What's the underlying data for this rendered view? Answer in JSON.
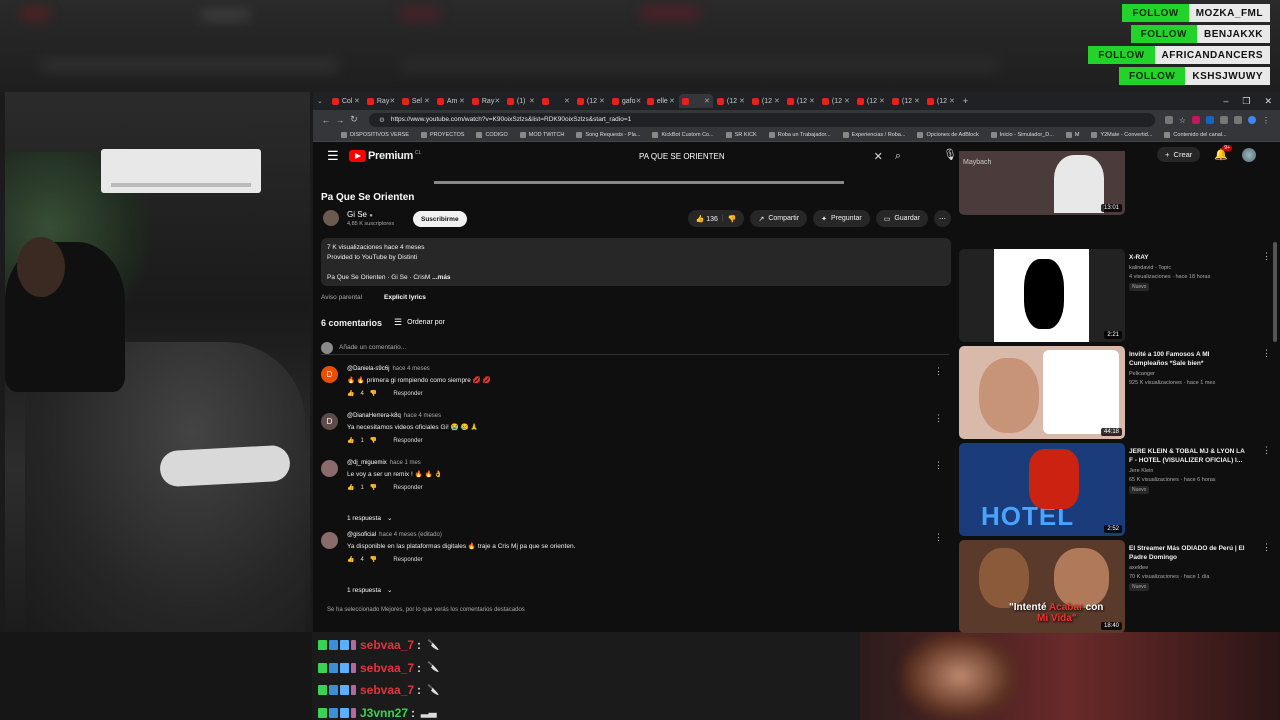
{
  "follows": [
    {
      "label": "FOLLOW",
      "user": "MOZKA_FML"
    },
    {
      "label": "FOLLOW",
      "user": "BENJAKXK"
    },
    {
      "label": "FOLLOW",
      "user": "AFRICANDANCERS"
    },
    {
      "label": "FOLLOW",
      "user": "KSHSJWUWY"
    }
  ],
  "browser": {
    "tabs": [
      "Col",
      "Ray",
      "Sel",
      "Am",
      "Ray",
      "(1)",
      "",
      "(12",
      "gafo",
      "elle",
      "",
      "(12",
      "(12",
      "(12",
      "(12",
      "(12",
      "(12",
      "(12"
    ],
    "url": "https://www.youtube.com/watch?v=K90oixSzlzs&list=RDK90oixSzlzs&start_radio=1",
    "bookmarks": [
      "DISPOSITIVOS VERSE",
      "PROYECTOS",
      "CODIGO",
      "MOD TWITCH",
      "Song Requests - Pla...",
      "KickBot Custom Co...",
      "SR KICK",
      "Roba un Trabajador...",
      "Experiencias / Roba...",
      "Opciones de AdBlock",
      "Inicio - Simulador_D...",
      "M",
      "Y2Mate - Convertid...",
      "Contenido del canal..."
    ]
  },
  "header": {
    "logo": "Premium",
    "logo_region": "CL",
    "search_query": "PA QUE SE ORIENTEN",
    "create_label": "Crear",
    "notif_count": "9+"
  },
  "video": {
    "title": "Pa Que Se Orienten",
    "channel": "Gi Se",
    "subs": "4,85 K suscriptores",
    "subscribe": "Suscribirme",
    "likes": "136",
    "share": "Compartir",
    "ask": "Preguntar",
    "save": "Guardar",
    "desc_line1": "7 K visualizaciones  hace 4 meses",
    "desc_line2": "Provided to YouTube by Distinti",
    "desc_line3": "Pa Que Se Orienten · Gi Se · CrisM",
    "desc_more": "...más",
    "parental": "Aviso parental",
    "explicit": "Explicit lyrics"
  },
  "comments": {
    "count_label": "6 comentarios",
    "sort_label": "Ordenar por",
    "add_placeholder": "Añade un comentario...",
    "reply_label": "Responder",
    "items": [
      {
        "initial": "D",
        "color": "#e65100",
        "author": "@Daniela-s9c6j",
        "time": "hace 4 meses",
        "text": "🔥 🔥 primera gi rompiendo como siempre 💋 💋",
        "likes": "4"
      },
      {
        "initial": "D",
        "color": "#5d4a4a",
        "author": "@DianaHerrera-k8q",
        "time": "hace 4 meses",
        "text": "Ya necesitamos videos oficiales Gi! 😭 😢 🙏",
        "likes": "1"
      },
      {
        "initial": "",
        "color": "#8a6a6a",
        "author": "@dj_miguemix",
        "time": "hace 1 mes",
        "text": "Le voy a ser un remix ! 🔥 🔥 👌",
        "likes": "1"
      },
      {
        "initial": "",
        "color": "#8a6a6a",
        "author": "@gisoficial",
        "time": "hace 4 meses (editado)",
        "text": "Ya disponible en las plataformas digitales 🔥 traje a Cris Mj pa que se orienten.",
        "likes": "4"
      }
    ],
    "replies_label": "1 respuesta",
    "footer_note": "Se ha seleccionado Mejores, por lo que verás los comentarios destacados"
  },
  "sidebar": [
    {
      "title": "",
      "channel": "",
      "views": "",
      "badge": "",
      "duration": "13:01",
      "thumb": "#4b3b3b"
    },
    {
      "title": "X-RAY",
      "channel": "kalindavid - Topic",
      "views": "4 visualizaciones · hace 18 horas",
      "badge": "Nuevo",
      "duration": "2:21",
      "thumb": "#222"
    },
    {
      "title": "Invité a 100 Famosos A MI Cumpleaños *Sale bien*",
      "channel": "Pelicanger",
      "views": "925 K visualizaciones · hace 1 mes",
      "badge": "",
      "duration": "44:18",
      "thumb": "#d9b9a9"
    },
    {
      "title": "JERE KLEIN & TOBAL MJ & LYON LA F - HOTEL (VISUALIZER OFICIAL) I...",
      "channel": "Jere Klein",
      "views": "65 K visualizaciones · hace 6 horas",
      "badge": "Nuevo",
      "duration": "2:52",
      "thumb": "#1a3c7a"
    },
    {
      "title": "El Streamer Más ODIADO de Perú | El Padre Domingo",
      "channel": "axeldee",
      "views": "70 K visualizaciones · hace 1 día",
      "badge": "Nuevo",
      "duration": "18:40",
      "thumb": "#5a3a2a"
    }
  ],
  "sidebar_overlay": {
    "thumb1_text": "Maybach",
    "thumb4_text": "HOTEL",
    "thumb5_text1": "\"Intenté",
    "thumb5_text2": "Acabar",
    "thumb5_text3": "con",
    "thumb5_text4": "Mi Vida\""
  },
  "chat": [
    {
      "user": "sebvaa_7",
      "color": "#e0343f",
      "msg": "🔪"
    },
    {
      "user": "sebvaa_7",
      "color": "#e0343f",
      "msg": "🔪"
    },
    {
      "user": "sebvaa_7",
      "color": "#e0343f",
      "msg": "🔪"
    },
    {
      "user": "J3vnn27",
      "color": "#39d353",
      "msg": "▂▃"
    }
  ]
}
